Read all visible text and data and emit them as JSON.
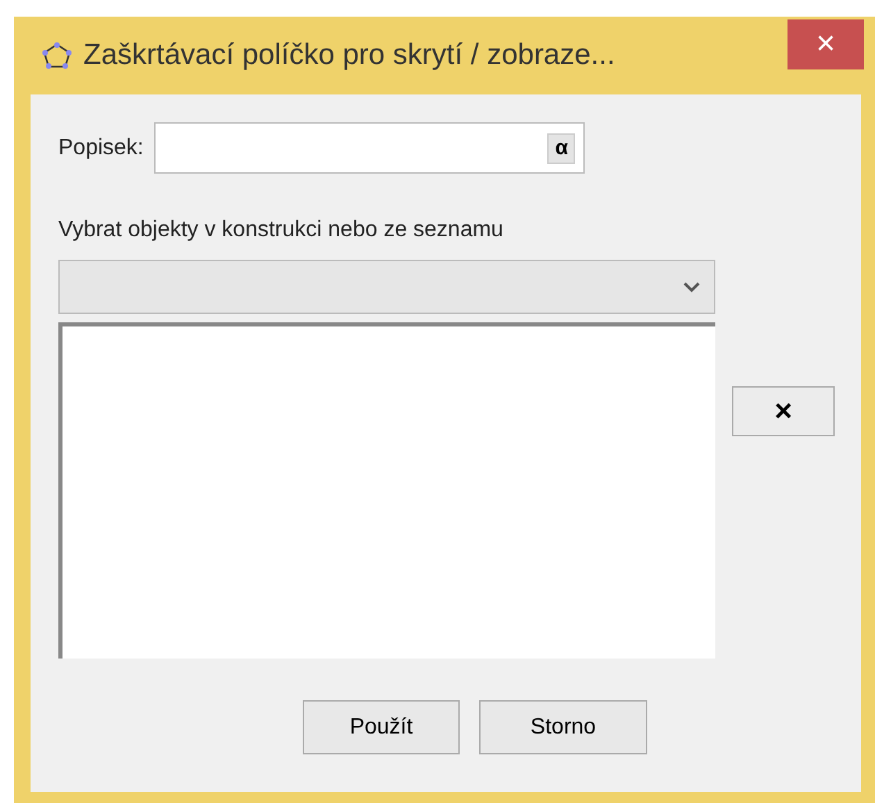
{
  "window": {
    "title": "Zaškrtávací políčko pro skrytí / zobraze...",
    "close": "×"
  },
  "caption": {
    "label": "Popisek:",
    "symbol_button": "α"
  },
  "objects": {
    "label": "Vybrat objekty v konstrukci nebo ze seznamu",
    "remove_button": "×"
  },
  "buttons": [
    {
      "label": "Použít"
    },
    {
      "label": "Storno"
    }
  ]
}
